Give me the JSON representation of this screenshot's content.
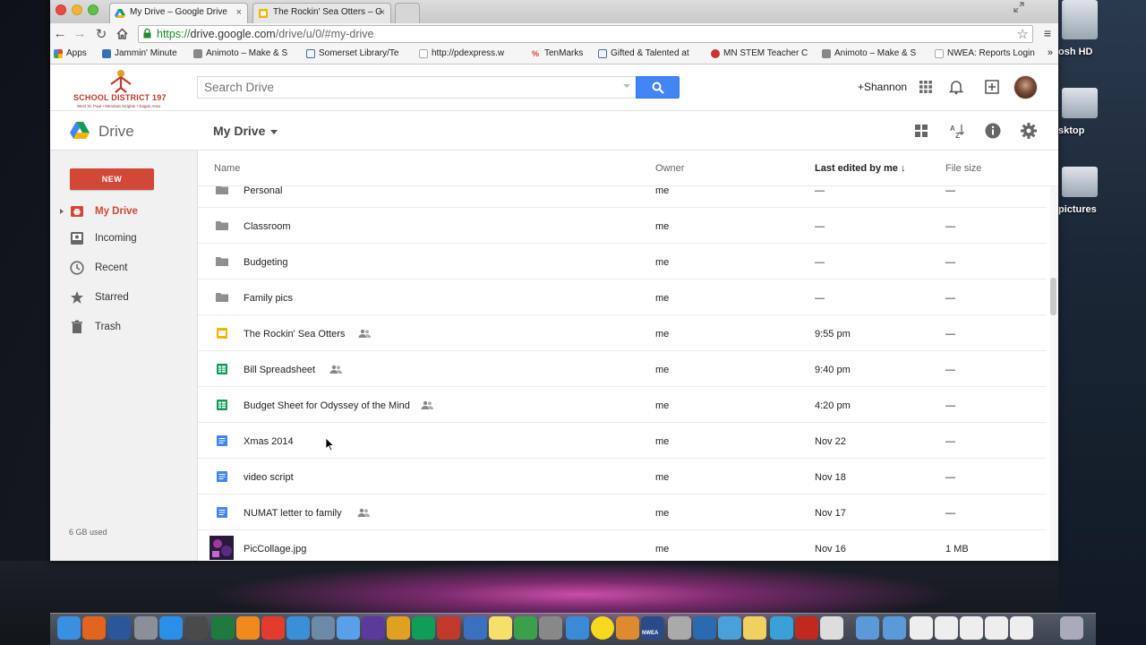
{
  "browser": {
    "tabs": [
      {
        "title": "My Drive – Google Drive",
        "close": "×"
      },
      {
        "title": "The Rockin' Sea Otters – G",
        "close": "×"
      }
    ],
    "url_secure": "https://",
    "url_host": "drive.google.com",
    "url_path": "/drive/u/0/#my-drive",
    "bookmarks": [
      "Apps",
      "Jammin' Minute",
      "Animoto – Make & S",
      "Somerset Library/Te",
      "http://pdexpress.w",
      "TenMarks",
      "Gifted & Talented at",
      "MN STEM Teacher C",
      "Animoto – Make & S",
      "NWEA: Reports Login"
    ],
    "bookmarks_more": "»"
  },
  "desktop": {
    "labels": [
      "osh HD",
      "sktop",
      "pictures"
    ]
  },
  "header": {
    "logo_text": "SCHOOL DISTRICT 197",
    "logo_sub": "West St. Paul • Mendota Heights • Eagan Area",
    "search_placeholder": "Search Drive",
    "user": "+Shannon"
  },
  "drivebar": {
    "app_name": "Drive",
    "location": "My Drive"
  },
  "sidebar": {
    "new_label": "NEW",
    "items": [
      {
        "label": "My Drive",
        "icon": "my-drive-icon"
      },
      {
        "label": "Incoming",
        "icon": "incoming-icon"
      },
      {
        "label": "Recent",
        "icon": "clock-icon"
      },
      {
        "label": "Starred",
        "icon": "star-icon"
      },
      {
        "label": "Trash",
        "icon": "trash-icon"
      }
    ],
    "storage": "6 GB used"
  },
  "list": {
    "columns": {
      "name": "Name",
      "owner": "Owner",
      "edited": "Last edited by me ↓",
      "size": "File size"
    },
    "rows": [
      {
        "name": "Personal",
        "type": "folder",
        "shared": false,
        "owner": "me",
        "edited": "—",
        "size": "—"
      },
      {
        "name": "Classroom",
        "type": "folder",
        "shared": false,
        "owner": "me",
        "edited": "—",
        "size": "—"
      },
      {
        "name": "Budgeting",
        "type": "folder",
        "shared": false,
        "owner": "me",
        "edited": "—",
        "size": "—"
      },
      {
        "name": "Family pics",
        "type": "folder",
        "shared": false,
        "owner": "me",
        "edited": "—",
        "size": "—"
      },
      {
        "name": "The Rockin' Sea Otters",
        "type": "slides",
        "shared": true,
        "owner": "me",
        "edited": "9:55 pm",
        "size": "—"
      },
      {
        "name": "Bill Spreadsheet",
        "type": "sheet",
        "shared": true,
        "owner": "me",
        "edited": "9:40 pm",
        "size": "—"
      },
      {
        "name": "Budget Sheet for Odyssey of the Mind",
        "type": "sheet",
        "shared": true,
        "owner": "me",
        "edited": "4:20 pm",
        "size": "—"
      },
      {
        "name": "Xmas 2014",
        "type": "doc",
        "shared": false,
        "owner": "me",
        "edited": "Nov 22",
        "size": "—"
      },
      {
        "name": "video script",
        "type": "doc",
        "shared": false,
        "owner": "me",
        "edited": "Nov 18",
        "size": "—"
      },
      {
        "name": "NUMAT letter to family",
        "type": "doc",
        "shared": true,
        "owner": "me",
        "edited": "Nov 17",
        "size": "—"
      },
      {
        "name": "PicCollage.jpg",
        "type": "image",
        "shared": false,
        "owner": "me",
        "edited": "Nov 16",
        "size": "1 MB"
      }
    ]
  },
  "dock": {
    "nwea_label": "NWEA"
  },
  "colors": {
    "accent_red": "#d14836",
    "search_blue": "#4285f4",
    "folder_gray": "#8f8f8f",
    "sheet_green": "#0f9d58",
    "doc_blue": "#4285f4",
    "slides_yellow": "#f4b400"
  }
}
